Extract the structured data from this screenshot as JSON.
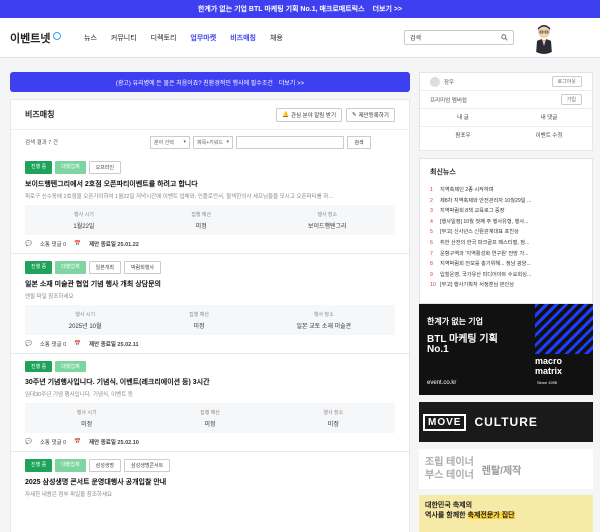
{
  "topbar": {
    "text": "한계가 없는 기업 BTL 마케팅 기획 No.1, 매크로매트릭스",
    "more": "더보기 >>"
  },
  "header": {
    "logo": "이벤트넷",
    "nav": [
      "뉴스",
      "커뮤니티",
      "디렉토리",
      "업무마켓",
      "비즈매칭",
      "채용"
    ],
    "active_nav": "비즈매칭",
    "search_placeholder": "검색"
  },
  "banner": {
    "text": "(광고) 유리병에 든 물은 처음이죠? 친환경적인 행사에 필수조건",
    "more": "더보기 >>"
  },
  "main": {
    "title": "비즈매칭",
    "btn_interest": "관심 분야 알림 받기",
    "btn_write": "제안등록하기",
    "count": "검색 결과 7 건",
    "select_field": "분야 선택",
    "select_type": "제목+키워드",
    "search_btn": "검색",
    "items": [
      {
        "tags": [
          "진행 중",
          "대행업체",
          "오프라인"
        ],
        "title": "보이드행텐그리에서 2호점 오픈파티이벤트를 하려고 합니다",
        "desc": "피로구 신수동에 2호점을 오픈가려하여 1월22일 저녁시간에 이벤트 업체와, 인플로언서, 팔색한의사 세프님들을 모시고 오픈파티를 하...",
        "info": [
          {
            "label": "행사 시기",
            "value": "1월22일"
          },
          {
            "label": "집행 예산",
            "value": "미정"
          },
          {
            "label": "행사 장소",
            "value": "보이드행텐그리"
          }
        ],
        "comments": "소통 댓글 0",
        "deadline": "제안 종료일 25.01.22"
      },
      {
        "tags": [
          "진행 중",
          "대행업체",
          "일본개최",
          "박람회행사"
        ],
        "title": "일본 소재 미술관 협업 기념 행사 개최 상담문의",
        "desc": "엔필 파일 참조하세요",
        "info": [
          {
            "label": "행사 시기",
            "value": "2025년 10월"
          },
          {
            "label": "집행 예산",
            "value": "미정"
          },
          {
            "label": "행사 장소",
            "value": "일본 교토 소재 미술관"
          }
        ],
        "comments": "소통 댓글 0",
        "deadline": "제안 종료일 25.02.11"
      },
      {
        "tags": [
          "진행 중",
          "대행업체"
        ],
        "title": "30주년 기념행사입니다. 기념식, 이벤트(레크리에이션 등) 3시간",
        "desc": "임대30주년 기념 행사입니다. 기념식, 이벤트 등",
        "info": [
          {
            "label": "행사 시기",
            "value": "미정"
          },
          {
            "label": "집행 예산",
            "value": "미정"
          },
          {
            "label": "행사 장소",
            "value": "미정"
          }
        ],
        "comments": "소통 댓글 0",
        "deadline": "제안 종료일 25.02.10"
      },
      {
        "tags": [
          "진행 중",
          "대행업체",
          "삼성생명",
          "삼성생명콘서트"
        ],
        "title": "2025 삼성생명 콘서트 운영대행사 공개입찰 안내",
        "desc": "자세한 내용은 첨부 파일을 참조하세요",
        "info": [],
        "comments": "",
        "deadline": ""
      }
    ]
  },
  "profile": {
    "name": "장우",
    "logout": "로그아웃",
    "membership": "프리미엄 멤버쉽",
    "join": "가입",
    "my_posts": "내 글",
    "my_comments": "내 댓글",
    "board": "팜포우",
    "event_edit": "이벤트 수정"
  },
  "news": {
    "title": "최신뉴스",
    "items": [
      "지역축제인 2종 시작하며",
      "제8차 지역축제와 안전관리자 10월29일 ...",
      "지역박람회 8책 교육로그 중장",
      "[행사일정] 10월 첫째 주 행사유형, 행사...",
      "[부고] 신사년스 신원관계대표 포친상",
      "취한 산전의 한국 파크골프 페스티벌, 정...",
      "운항구역과 '지역활성화 연구원' 전망 가...",
      "지역박람회 전모를 총기위해... 정남 광양...",
      "입힐운영, 국가유산 미디어아트 수요회싱...",
      "[부고] 행사기획자 서정훈님 본인상"
    ]
  },
  "ads": {
    "ad1_line1": "한계가 없는 기업",
    "ad1_line2": "BTL 마케팅 기획",
    "ad1_line3": "No.1",
    "ad1_url": "event.co.kr",
    "ad1_brand1": "macro",
    "ad1_brand2": "matrix",
    "ad1_since": "Since 1995",
    "ad2_move": "MOVE",
    "ad2_culture": "CULTURE",
    "ad3_line1": "조립 테이너",
    "ad3_line2": "부스 테이너",
    "ad3_right": "렌탈/제작",
    "ad4_line1": "대한민국 축제의",
    "ad4_line2": "역사를 함께한",
    "ad4_hl": "축제전문가 집단"
  },
  "colors": {
    "brand": "#3d3ff0",
    "green": "#1fa35a",
    "red": "#e2333b"
  }
}
